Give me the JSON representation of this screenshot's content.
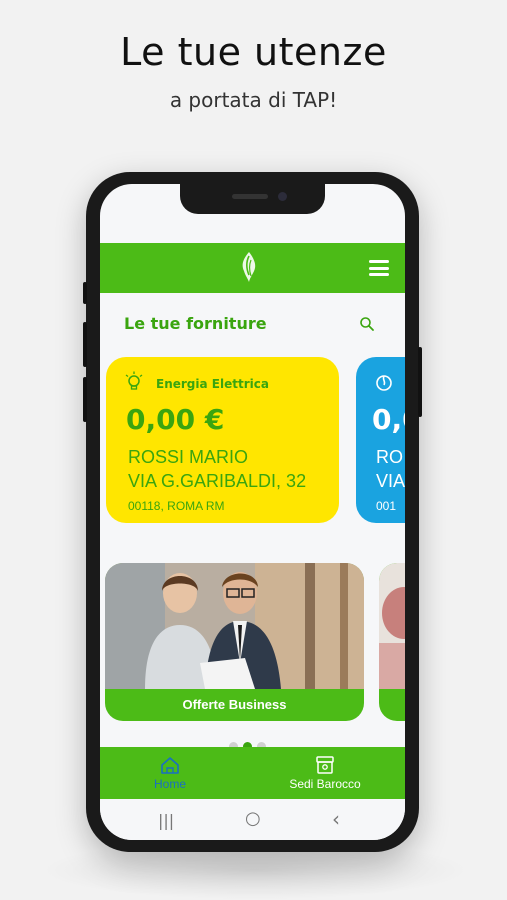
{
  "promo_header": {
    "title": "Le tue utenze",
    "subtitle": "a portata di TAP!"
  },
  "app": {
    "section_title": "Le tue forniture",
    "brand_color": "#4cbb17",
    "accent_text_color": "#3aa50f",
    "icons": {
      "logo": "flame-leaf-logo-icon",
      "menu": "hamburger-menu-icon",
      "search": "search-icon"
    }
  },
  "cards": [
    {
      "type_label": "Energia Elettrica",
      "icon": "lightbulb-icon",
      "amount": "0,00 €",
      "name": "ROSSI MARIO",
      "address": "VIA G.GARIBALDI, 32",
      "city": "00118, ROMA RM",
      "color": "#ffe600"
    },
    {
      "type_label": "",
      "icon": "gas-flame-icon",
      "amount": "0,0",
      "name": "RO",
      "address": "VIA",
      "city": "001",
      "color": "#1aa3e0"
    }
  ],
  "promos": [
    {
      "label": "Offerte Business"
    },
    {
      "label": ""
    }
  ],
  "carousel": {
    "pages": 3,
    "active_index": 1
  },
  "bottom_nav": [
    {
      "label": "Home",
      "icon": "home-icon",
      "active": true
    },
    {
      "label": "Sedi Barocco",
      "icon": "store-location-icon",
      "active": false
    }
  ],
  "system_nav": {
    "recents": "|||",
    "home": "○",
    "back": "‹"
  }
}
